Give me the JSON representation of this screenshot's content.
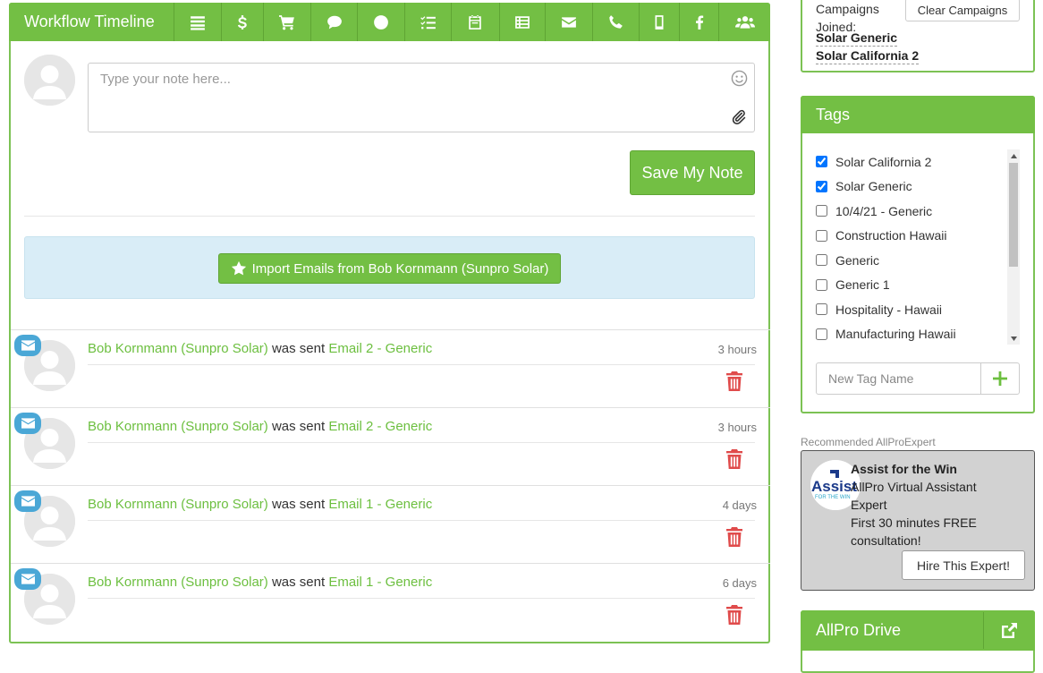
{
  "timeline": {
    "title": "Workflow Timeline",
    "toolbar": [
      {
        "icon": "list-icon"
      },
      {
        "icon": "dollar-icon"
      },
      {
        "icon": "cart-icon"
      },
      {
        "icon": "comment-icon"
      },
      {
        "icon": "clock-icon"
      },
      {
        "icon": "checklist-icon"
      },
      {
        "icon": "calendar-icon"
      },
      {
        "icon": "table-icon"
      },
      {
        "icon": "envelope-icon"
      },
      {
        "icon": "phone-icon"
      },
      {
        "icon": "mobile-icon"
      },
      {
        "icon": "facebook-icon"
      },
      {
        "icon": "users-icon"
      }
    ],
    "note_placeholder": "Type your note here...",
    "save_label": "Save My Note",
    "import_label": "Import Emails from Bob Kornmann (Sunpro Solar)",
    "entries": [
      {
        "contact": "Bob Kornmann (Sunpro Solar)",
        "action": "was sent",
        "email": "Email 2 - Generic",
        "time": "3 hours"
      },
      {
        "contact": "Bob Kornmann (Sunpro Solar)",
        "action": "was sent",
        "email": "Email 2 - Generic",
        "time": "3 hours"
      },
      {
        "contact": "Bob Kornmann (Sunpro Solar)",
        "action": "was sent",
        "email": "Email 1 - Generic",
        "time": "4 days"
      },
      {
        "contact": "Bob Kornmann (Sunpro Solar)",
        "action": "was sent",
        "email": "Email 1 - Generic",
        "time": "6 days"
      }
    ]
  },
  "campaigns": {
    "label_line1": "Campaigns",
    "label_line2": "Joined:",
    "clear_label": "Clear Campaigns",
    "items": [
      "Solar Generic",
      "Solar California 2"
    ]
  },
  "tags": {
    "title": "Tags",
    "items": [
      {
        "label": "Solar California 2",
        "checked": true
      },
      {
        "label": "Solar Generic",
        "checked": true
      },
      {
        "label": "10/4/21 - Generic",
        "checked": false
      },
      {
        "label": "Construction Hawaii",
        "checked": false
      },
      {
        "label": "Generic",
        "checked": false
      },
      {
        "label": "Generic 1",
        "checked": false
      },
      {
        "label": "Hospitality - Hawaii",
        "checked": false
      },
      {
        "label": "Manufacturing Hawaii",
        "checked": false
      }
    ],
    "new_tag_placeholder": "New Tag Name"
  },
  "recommended": {
    "label": "Recommended AllProExpert",
    "name": "Assist for the Win",
    "title_line1": "AllPro Virtual Assistant",
    "title_line2": "Expert",
    "offer_line1": "First 30 minutes FREE",
    "offer_line2": "consultation!",
    "hire_label": "Hire This Expert!",
    "logo_text": "Assist",
    "logo_subtext": "FOR THE WIN"
  },
  "drive": {
    "title": "AllPro Drive"
  },
  "colors": {
    "accent": "#73bf44",
    "link": "#6cbf3f",
    "info_bg": "#d9edf7",
    "mail_badge": "#4aa7d6",
    "danger": "#e04b4b"
  }
}
